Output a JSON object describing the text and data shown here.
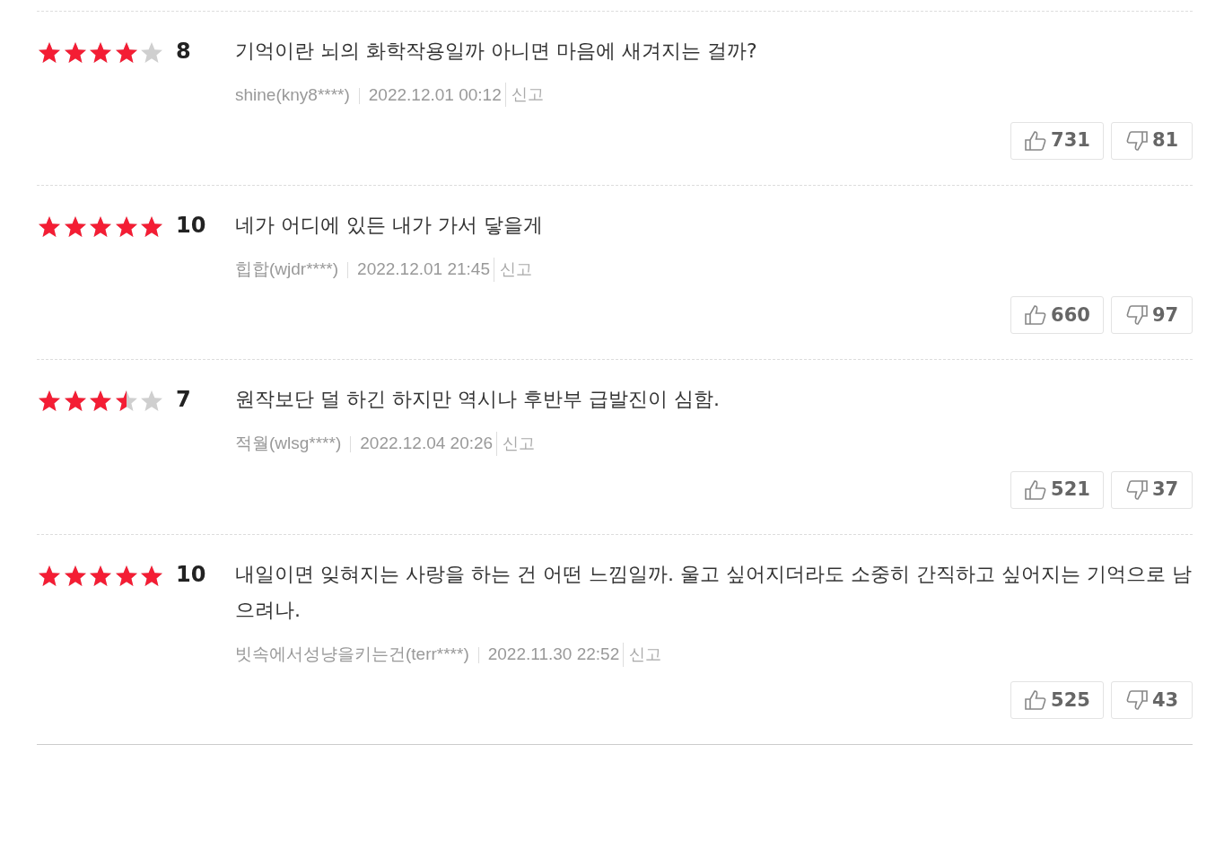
{
  "reviews": [
    {
      "stars": 4,
      "score": "8",
      "text": "기억이란 뇌의 화학작용일까 아니면 마음에 새겨지는 걸까?",
      "author": "shine(kny8****)",
      "date": "2022.12.01 00:12",
      "report": "신고",
      "likes": "731",
      "dislikes": "81"
    },
    {
      "stars": 5,
      "score": "10",
      "text": "네가 어디에 있든 내가 가서 닿을게",
      "author": "힙합(wjdr****)",
      "date": "2022.12.01 21:45",
      "report": "신고",
      "likes": "660",
      "dislikes": "97"
    },
    {
      "stars": 3.5,
      "score": "7",
      "text": "원작보단 덜 하긴 하지만 역시나 후반부 급발진이 심함.",
      "author": "적월(wlsg****)",
      "date": "2022.12.04 20:26",
      "report": "신고",
      "likes": "521",
      "dislikes": "37"
    },
    {
      "stars": 5,
      "score": "10",
      "text": "내일이면 잊혀지는 사랑을 하는 건 어떤 느낌일까. 울고 싶어지더라도 소중히 간직하고 싶어지는 기억으로 남으려나.",
      "author": "빗속에서성냥을키는건(terr****)",
      "date": "2022.11.30 22:52",
      "report": "신고",
      "likes": "525",
      "dislikes": "43"
    }
  ]
}
